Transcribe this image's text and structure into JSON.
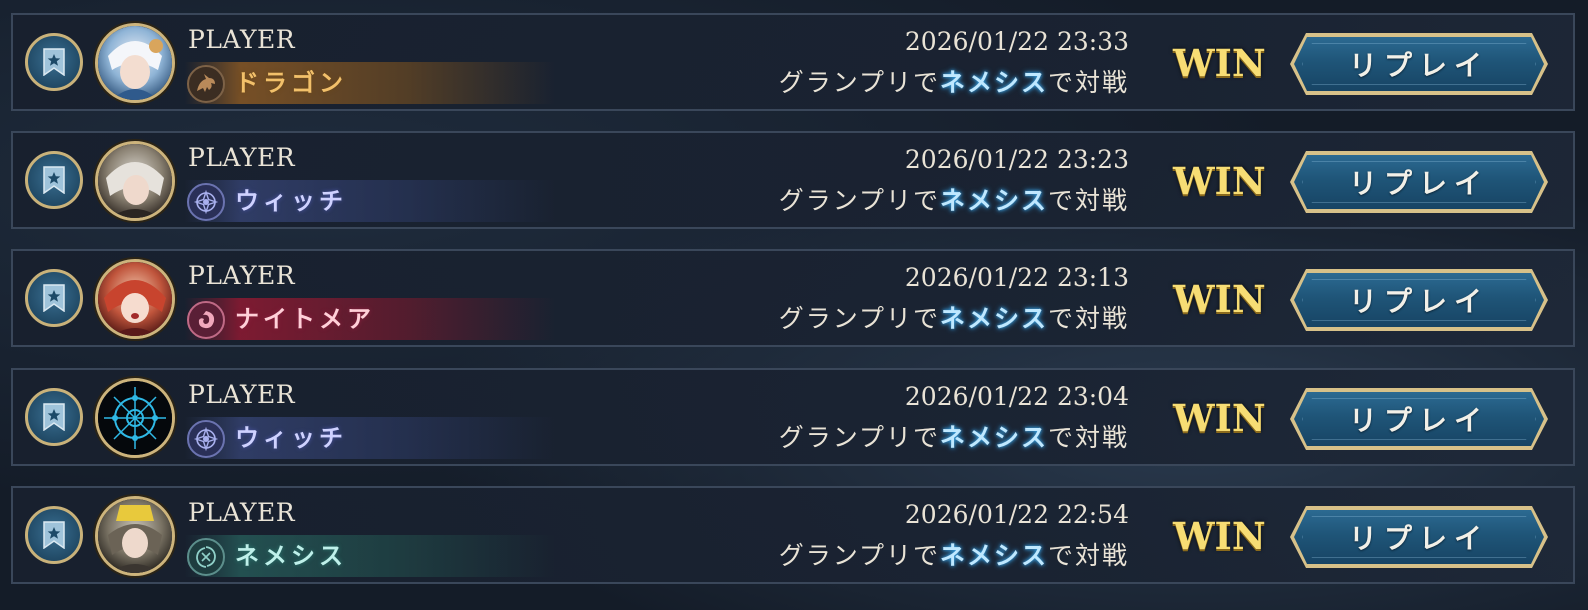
{
  "colors": {
    "background": "#141c28",
    "row_border": "#3a475a",
    "win_gold": "#f7dd74",
    "replay_blue": "#1f5578",
    "replay_border": "#d7c189",
    "deck_highlight": "#bfe8ff"
  },
  "matches": [
    {
      "player": "PLAYER",
      "class_name": "ドラゴン",
      "class_icon": "dragon-icon",
      "datetime": "2026/01/22 23:33",
      "mode_prefix": "グランプリで",
      "deck": "ネメシス",
      "mode_suffix": "で対戦",
      "result": "WIN",
      "replay_label": "リプレイ",
      "bookmark_icon": "star-bookmark-icon"
    },
    {
      "player": "PLAYER",
      "class_name": "ウィッチ",
      "class_icon": "witch-icon",
      "datetime": "2026/01/22 23:23",
      "mode_prefix": "グランプリで",
      "deck": "ネメシス",
      "mode_suffix": "で対戦",
      "result": "WIN",
      "replay_label": "リプレイ",
      "bookmark_icon": "star-bookmark-icon"
    },
    {
      "player": "PLAYER",
      "class_name": "ナイトメア",
      "class_icon": "nightmare-icon",
      "datetime": "2026/01/22 23:13",
      "mode_prefix": "グランプリで",
      "deck": "ネメシス",
      "mode_suffix": "で対戦",
      "result": "WIN",
      "replay_label": "リプレイ",
      "bookmark_icon": "star-bookmark-icon"
    },
    {
      "player": "PLAYER",
      "class_name": "ウィッチ",
      "class_icon": "witch-icon",
      "datetime": "2026/01/22 23:04",
      "mode_prefix": "グランプリで",
      "deck": "ネメシス",
      "mode_suffix": "で対戦",
      "result": "WIN",
      "replay_label": "リプレイ",
      "bookmark_icon": "star-bookmark-icon"
    },
    {
      "player": "PLAYER",
      "class_name": "ネメシス",
      "class_icon": "nemesis-icon",
      "datetime": "2026/01/22 22:54",
      "mode_prefix": "グランプリで",
      "deck": "ネメシス",
      "mode_suffix": "で対戦",
      "result": "WIN",
      "replay_label": "リプレイ",
      "bookmark_icon": "star-bookmark-icon"
    }
  ]
}
